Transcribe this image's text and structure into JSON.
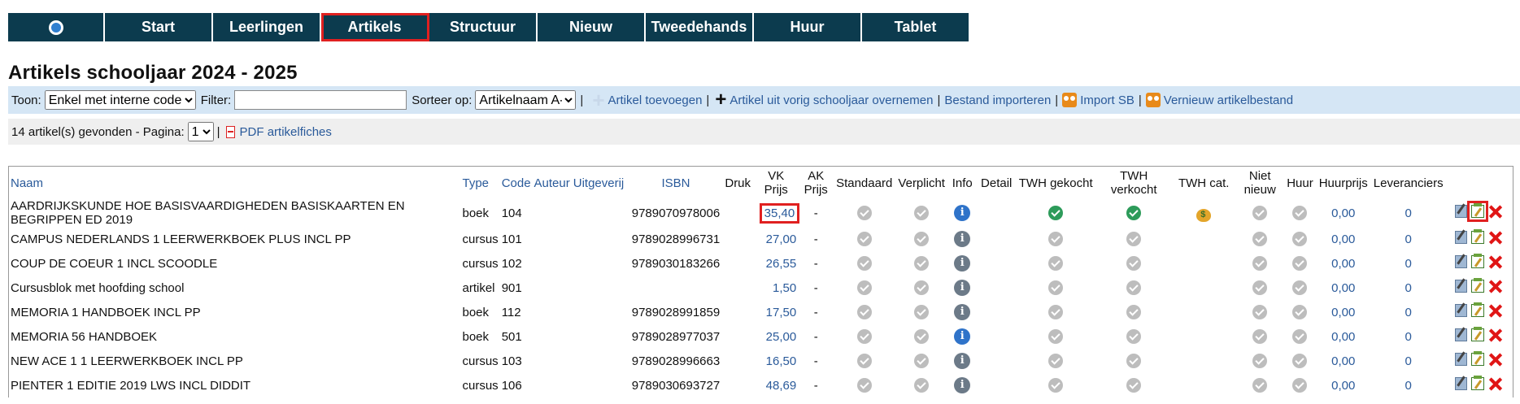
{
  "nav": {
    "items": [
      "Start",
      "Leerlingen",
      "Artikels",
      "Structuur",
      "Nieuw",
      "Tweedehands",
      "Huur",
      "Tablet"
    ],
    "active": "Artikels",
    "accent": "#0c3b4e",
    "highlight": "#e02020"
  },
  "page_title": "Artikels schooljaar 2024 - 2025",
  "toolbar": {
    "toon_label": "Toon:",
    "toon_value": "Enkel met interne code",
    "filter_label": "Filter:",
    "filter_value": "",
    "sorteer_label": "Sorteer op:",
    "sorteer_value": "Artikelnaam A-Z",
    "add_article": "Artikel toevoegen",
    "copy_previous": "Artikel uit vorig schooljaar overnemen",
    "import_file": "Bestand importeren",
    "import_sb": "Import SB",
    "renew_file": "Vernieuw artikelbestand",
    "separator": "|"
  },
  "infobar": {
    "count_text": "14 artikel(s) gevonden - Pagina:",
    "page_value": "1",
    "pdf_label": "PDF artikelfiches"
  },
  "table": {
    "headers": {
      "naam": "Naam",
      "type": "Type",
      "code": "Code",
      "auteur": "Auteur",
      "uitgeverij": "Uitgeverij",
      "isbn": "ISBN",
      "druk": "Druk",
      "vk_prijs": "VK Prijs",
      "ak_prijs": "AK Prijs",
      "standaard": "Standaard",
      "verplicht": "Verplicht",
      "info": "Info",
      "detail": "Detail",
      "twh_gekocht": "TWH gekocht",
      "twh_verkocht": "TWH verkocht",
      "twh_cat": "TWH cat.",
      "niet_nieuw": "Niet nieuw",
      "huur": "Huur",
      "huurprijs": "Huurprijs",
      "leveranciers": "Leveranciers"
    },
    "rows": [
      {
        "naam": "AARDRIJKSKUNDE HOE BASISVAARDIGHEDEN BASISKAARTEN EN BEGRIPPEN ED 2019",
        "type": "boek",
        "code": "104",
        "isbn": "9789070978006",
        "vk": "35,40",
        "ak": "-",
        "info": "info-blue-icon",
        "twh_gekocht": true,
        "twh_verkocht": true,
        "twh_cat": "money-bag-icon",
        "huurprijs": "0,00",
        "leveranciers": "0"
      },
      {
        "naam": "CAMPUS NEDERLANDS 1 LEERWERKBOEK PLUS INCL PP",
        "type": "cursus",
        "code": "101",
        "isbn": "9789028996731",
        "vk": "27,00",
        "ak": "-",
        "info": "info-grey-icon",
        "twh_gekocht": false,
        "twh_verkocht": false,
        "twh_cat": "",
        "huurprijs": "0,00",
        "leveranciers": "0"
      },
      {
        "naam": "COUP DE COEUR 1 INCL SCOODLE",
        "type": "cursus",
        "code": "102",
        "isbn": "9789030183266",
        "vk": "26,55",
        "ak": "-",
        "info": "info-grey-icon",
        "twh_gekocht": false,
        "twh_verkocht": false,
        "twh_cat": "",
        "huurprijs": "0,00",
        "leveranciers": "0"
      },
      {
        "naam": "Cursusblok met hoofding school",
        "type": "artikel",
        "code": "901",
        "isbn": "",
        "vk": "1,50",
        "ak": "-",
        "info": "info-grey-icon",
        "twh_gekocht": false,
        "twh_verkocht": false,
        "twh_cat": "",
        "huurprijs": "0,00",
        "leveranciers": "0"
      },
      {
        "naam": "MEMORIA 1 HANDBOEK INCL PP",
        "type": "boek",
        "code": "112",
        "isbn": "9789028991859",
        "vk": "17,50",
        "ak": "-",
        "info": "info-grey-icon",
        "twh_gekocht": false,
        "twh_verkocht": false,
        "twh_cat": "",
        "huurprijs": "0,00",
        "leveranciers": "0"
      },
      {
        "naam": "MEMORIA 56 HANDBOEK",
        "type": "boek",
        "code": "501",
        "isbn": "9789028977037",
        "vk": "25,00",
        "ak": "-",
        "info": "info-blue-icon",
        "twh_gekocht": false,
        "twh_verkocht": false,
        "twh_cat": "",
        "huurprijs": "0,00",
        "leveranciers": "0"
      },
      {
        "naam": "NEW ACE 1 1 LEERWERKBOEK INCL PP",
        "type": "cursus",
        "code": "103",
        "isbn": "9789028996663",
        "vk": "16,50",
        "ak": "-",
        "info": "info-grey-icon",
        "twh_gekocht": false,
        "twh_verkocht": false,
        "twh_cat": "",
        "huurprijs": "0,00",
        "leveranciers": "0"
      },
      {
        "naam": "PIENTER 1 EDITIE 2019 LWS INCL DIDDIT",
        "type": "cursus",
        "code": "106",
        "isbn": "9789030693727",
        "vk": "48,69",
        "ak": "-",
        "info": "info-grey-icon",
        "twh_gekocht": false,
        "twh_verkocht": false,
        "twh_cat": "",
        "huurprijs": "0,00",
        "leveranciers": "0"
      }
    ]
  }
}
